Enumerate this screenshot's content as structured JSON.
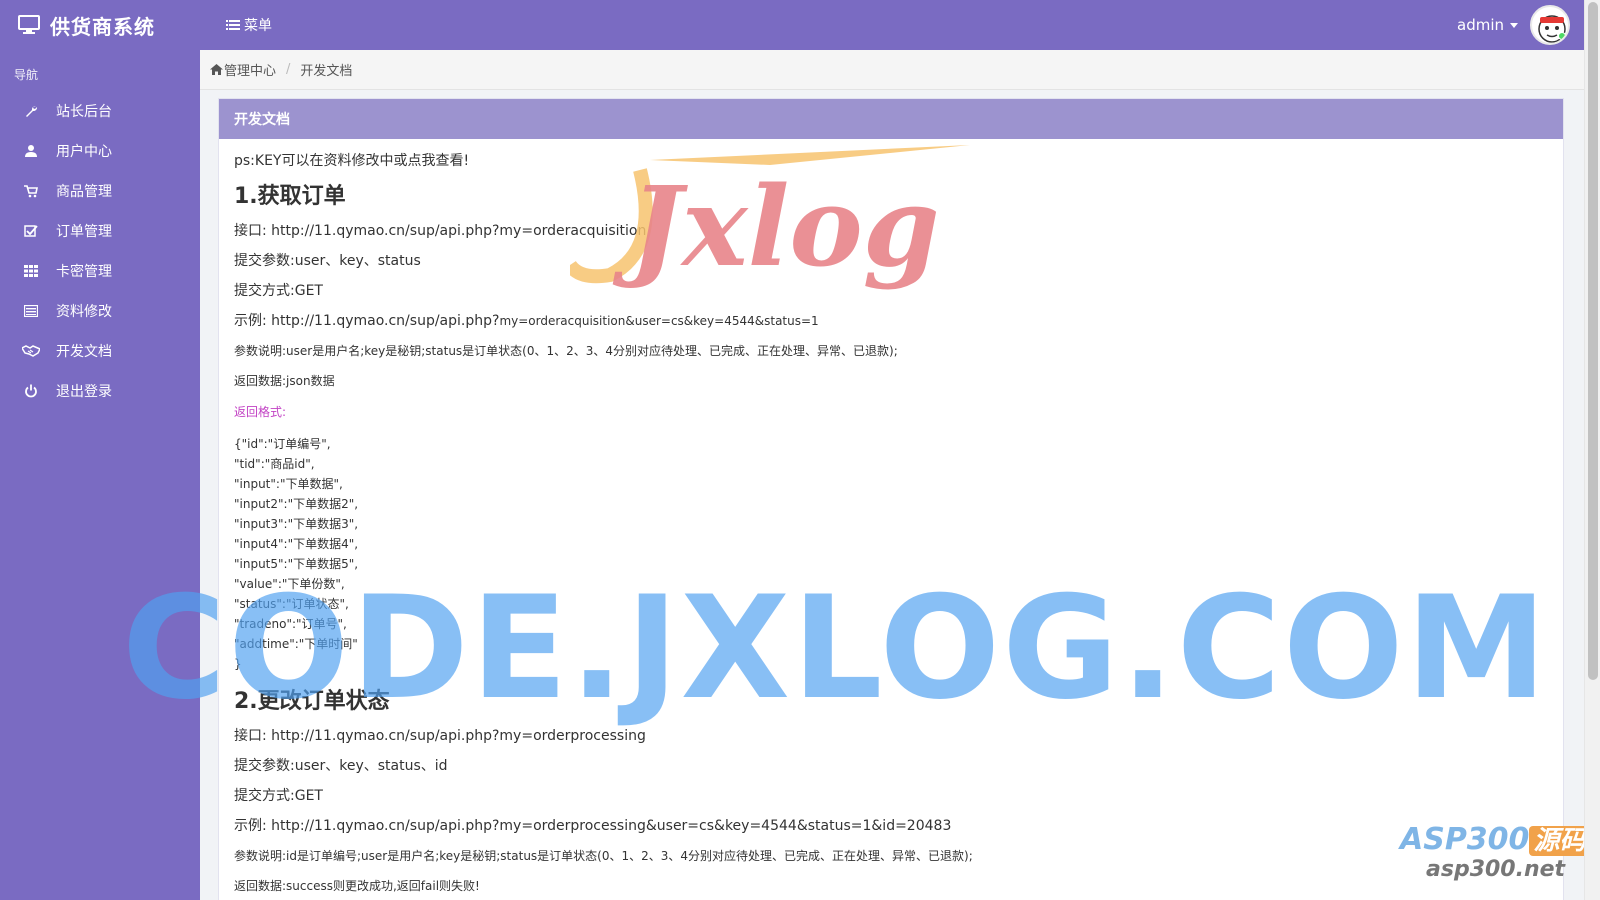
{
  "header": {
    "brand": "供货商系统",
    "menu_label": "菜单",
    "user": "admin"
  },
  "sidebar": {
    "nav_title": "导航",
    "items": [
      {
        "label": "站长后台",
        "icon": "wrench-icon"
      },
      {
        "label": "用户中心",
        "icon": "user-icon"
      },
      {
        "label": "商品管理",
        "icon": "cart-icon"
      },
      {
        "label": "订单管理",
        "icon": "checkbox-icon"
      },
      {
        "label": "卡密管理",
        "icon": "grid-icon"
      },
      {
        "label": "资料修改",
        "icon": "list-icon"
      },
      {
        "label": "开发文档",
        "icon": "handshake-icon"
      },
      {
        "label": "退出登录",
        "icon": "power-icon"
      }
    ]
  },
  "breadcrumb": {
    "home": "管理中心",
    "current": "开发文档"
  },
  "panel": {
    "heading": "开发文档",
    "note": "ps:KEY可以在资料修改中或点我查看!",
    "section1": {
      "title": "1.获取订单",
      "api_label": "接口:",
      "api": "http://11.qymao.cn/sup/api.php?my=orderacquisition",
      "params": "提交参数:user、key、status",
      "method": "提交方式:GET",
      "example_label": "示例:",
      "example_main": "http://11.qymao.cn/sup/api.php?",
      "example_rest": "my=orderacquisition&user=cs&key=4544&status=1",
      "explain": "参数说明:user是用户名;key是秘钥;status是订单状态(0、1、2、3、4分别对应待处理、已完成、正在处理、异常、已退款);",
      "return_data": "返回数据:json数据",
      "return_format": "返回格式:",
      "json_lines": [
        "{\"id\":\"订单编号\",",
        "\"tid\":\"商品id\",",
        "\"input\":\"下单数据\",",
        "\"input2\":\"下单数据2\",",
        "\"input3\":\"下单数据3\",",
        "\"input4\":\"下单数据4\",",
        "\"input5\":\"下单数据5\",",
        "\"value\":\"下单份数\",",
        "\"status\":\"订单状态\",",
        "\"tradeno\":\"订单号\",",
        "\"addtime\":\"下单时间\"",
        "}"
      ]
    },
    "section2": {
      "title": "2.更改订单状态",
      "api_label": "接口:",
      "api": "http://11.qymao.cn/sup/api.php?my=orderprocessing",
      "params": "提交参数:user、key、status、id",
      "method": "提交方式:GET",
      "example_label": "示例:",
      "example": "http://11.qymao.cn/sup/api.php?my=orderprocessing&user=cs&key=4544&status=1&id=20483",
      "explain": "参数说明:id是订单编号;user是用户名;key是秘钥;status是订单状态(0、1、2、3、4分别对应待处理、已完成、正在处理、异常、已退款);",
      "return_data": "返回数据:success则更改成功,返回fail则失败!"
    }
  },
  "watermarks": {
    "jxlog": "Jxlog",
    "code": "CODE.JXLOG.COM",
    "asp_main": "ASP300",
    "asp_tag": "源码",
    "asp_site": "asp300.net"
  },
  "colors": {
    "primary": "#7a6bc2",
    "panel_heading": "#9c93cf",
    "return_label": "#c242c4"
  }
}
